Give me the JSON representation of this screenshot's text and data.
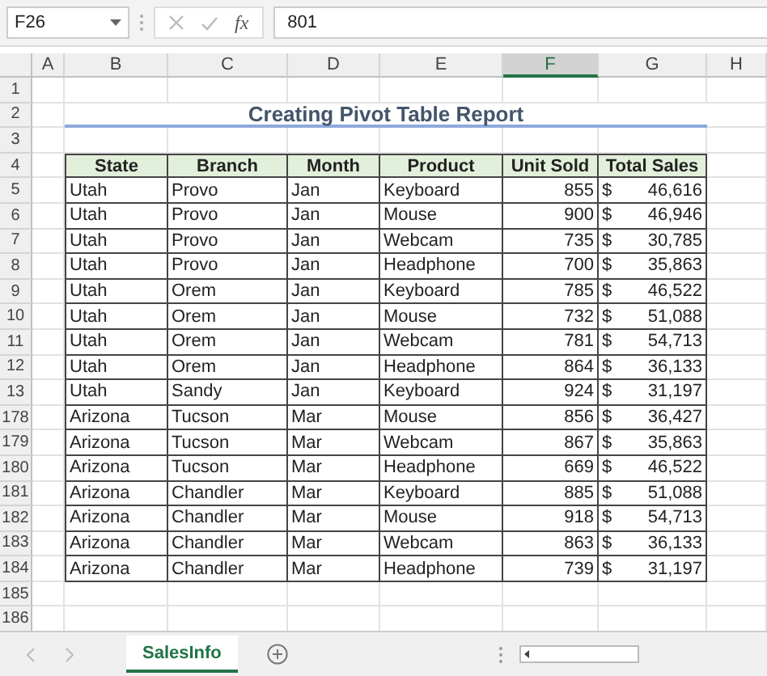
{
  "name_box": {
    "value": "F26"
  },
  "formula_bar": {
    "function_symbol": "fx",
    "value": "801"
  },
  "column_headers": [
    {
      "label": "A",
      "selected": false
    },
    {
      "label": "B",
      "selected": false
    },
    {
      "label": "C",
      "selected": false
    },
    {
      "label": "D",
      "selected": false
    },
    {
      "label": "E",
      "selected": false
    },
    {
      "label": "F",
      "selected": true
    },
    {
      "label": "G",
      "selected": false
    },
    {
      "label": "H",
      "selected": false
    }
  ],
  "rows": [
    {
      "row": "1",
      "kind": "blank"
    },
    {
      "row": "2",
      "kind": "title",
      "text": "Creating Pivot Table Report"
    },
    {
      "row": "3",
      "kind": "blank"
    },
    {
      "row": "4",
      "kind": "header",
      "cells": [
        "State",
        "Branch",
        "Month",
        "Product",
        "Unit Sold",
        "Total Sales"
      ]
    },
    {
      "row": "5",
      "kind": "data",
      "state": "Utah",
      "branch": "Provo",
      "month": "Jan",
      "product": "Keyboard",
      "units": "855",
      "currency": "$",
      "total": "46,616"
    },
    {
      "row": "6",
      "kind": "data",
      "state": "Utah",
      "branch": "Provo",
      "month": "Jan",
      "product": "Mouse",
      "units": "900",
      "currency": "$",
      "total": "46,946"
    },
    {
      "row": "7",
      "kind": "data",
      "state": "Utah",
      "branch": "Provo",
      "month": "Jan",
      "product": "Webcam",
      "units": "735",
      "currency": "$",
      "total": "30,785"
    },
    {
      "row": "8",
      "kind": "data",
      "state": "Utah",
      "branch": "Provo",
      "month": "Jan",
      "product": "Headphone",
      "units": "700",
      "currency": "$",
      "total": "35,863"
    },
    {
      "row": "9",
      "kind": "data",
      "state": "Utah",
      "branch": "Orem",
      "month": "Jan",
      "product": "Keyboard",
      "units": "785",
      "currency": "$",
      "total": "46,522"
    },
    {
      "row": "10",
      "kind": "data",
      "state": "Utah",
      "branch": "Orem",
      "month": "Jan",
      "product": "Mouse",
      "units": "732",
      "currency": "$",
      "total": "51,088"
    },
    {
      "row": "11",
      "kind": "data",
      "state": "Utah",
      "branch": "Orem",
      "month": "Jan",
      "product": "Webcam",
      "units": "781",
      "currency": "$",
      "total": "54,713"
    },
    {
      "row": "12",
      "kind": "data",
      "state": "Utah",
      "branch": "Orem",
      "month": "Jan",
      "product": "Headphone",
      "units": "864",
      "currency": "$",
      "total": "36,133"
    },
    {
      "row": "13",
      "kind": "data",
      "state": "Utah",
      "branch": "Sandy",
      "month": "Jan",
      "product": "Keyboard",
      "units": "924",
      "currency": "$",
      "total": "31,197"
    },
    {
      "row": "178",
      "kind": "data",
      "state": "Arizona",
      "branch": "Tucson",
      "month": "Mar",
      "product": "Mouse",
      "units": "856",
      "currency": "$",
      "total": "36,427"
    },
    {
      "row": "179",
      "kind": "data",
      "state": "Arizona",
      "branch": "Tucson",
      "month": "Mar",
      "product": "Webcam",
      "units": "867",
      "currency": "$",
      "total": "35,863"
    },
    {
      "row": "180",
      "kind": "data",
      "state": "Arizona",
      "branch": "Tucson",
      "month": "Mar",
      "product": "Headphone",
      "units": "669",
      "currency": "$",
      "total": "46,522"
    },
    {
      "row": "181",
      "kind": "data",
      "state": "Arizona",
      "branch": "Chandler",
      "month": "Mar",
      "product": "Keyboard",
      "units": "885",
      "currency": "$",
      "total": "51,088"
    },
    {
      "row": "182",
      "kind": "data",
      "state": "Arizona",
      "branch": "Chandler",
      "month": "Mar",
      "product": "Mouse",
      "units": "918",
      "currency": "$",
      "total": "54,713"
    },
    {
      "row": "183",
      "kind": "data",
      "state": "Arizona",
      "branch": "Chandler",
      "month": "Mar",
      "product": "Webcam",
      "units": "863",
      "currency": "$",
      "total": "36,133"
    },
    {
      "row": "184",
      "kind": "data",
      "state": "Arizona",
      "branch": "Chandler",
      "month": "Mar",
      "product": "Headphone",
      "units": "739",
      "currency": "$",
      "total": "31,197"
    },
    {
      "row": "185",
      "kind": "blank"
    },
    {
      "row": "186",
      "kind": "blank"
    }
  ],
  "sheet_tabs": [
    {
      "label": "SalesInfo",
      "selected": true
    }
  ]
}
